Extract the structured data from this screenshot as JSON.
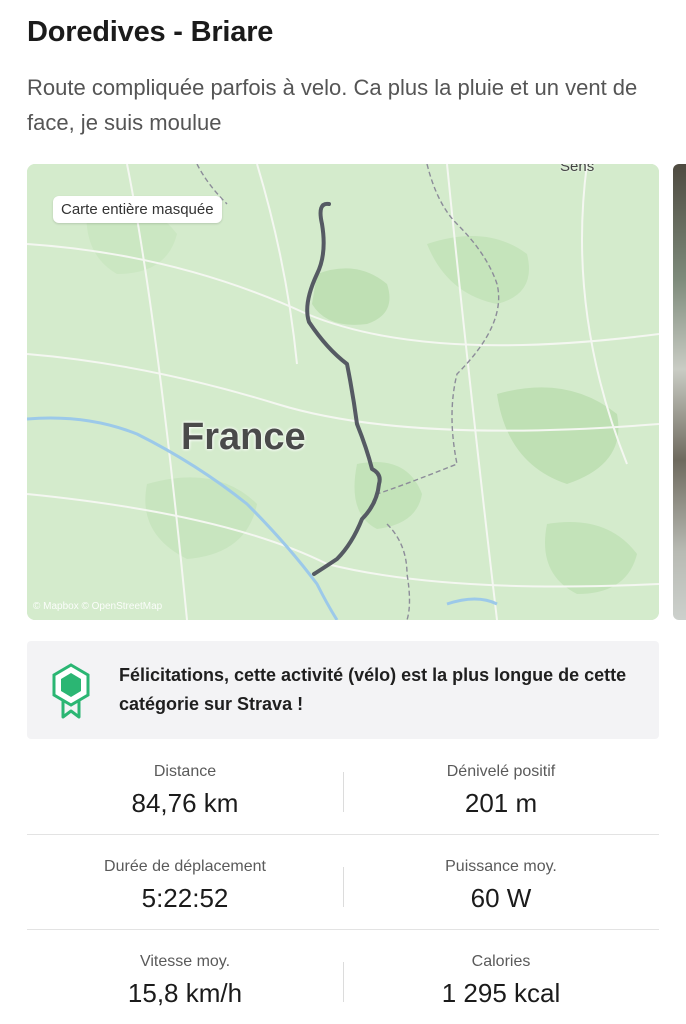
{
  "activity": {
    "title": "Doredives - Briare",
    "description": "Route compliquée parfois à velo. Ca plus la pluie et un vent de face, je suis moulue"
  },
  "map": {
    "badge": "Carte entière masquée",
    "country_label": "France",
    "city_label": "Sens",
    "attribution": "© Mapbox © OpenStreetMap",
    "route_color": "#555a63"
  },
  "achievement": {
    "icon": "medal-icon",
    "accent_color": "#2bb673",
    "text": "Félicitations, cette activité (vélo) est la plus longue de cette catégorie sur Strava !"
  },
  "stats": [
    {
      "left": {
        "label": "Distance",
        "value": "84,76 km"
      },
      "right": {
        "label": "Dénivelé positif",
        "value": "201 m"
      }
    },
    {
      "left": {
        "label": "Durée de déplacement",
        "value": "5:22:52"
      },
      "right": {
        "label": "Puissance moy.",
        "value": "60 W"
      }
    },
    {
      "left": {
        "label": "Vitesse moy.",
        "value": "15,8 km/h"
      },
      "right": {
        "label": "Calories",
        "value": "1 295 kcal"
      }
    }
  ]
}
